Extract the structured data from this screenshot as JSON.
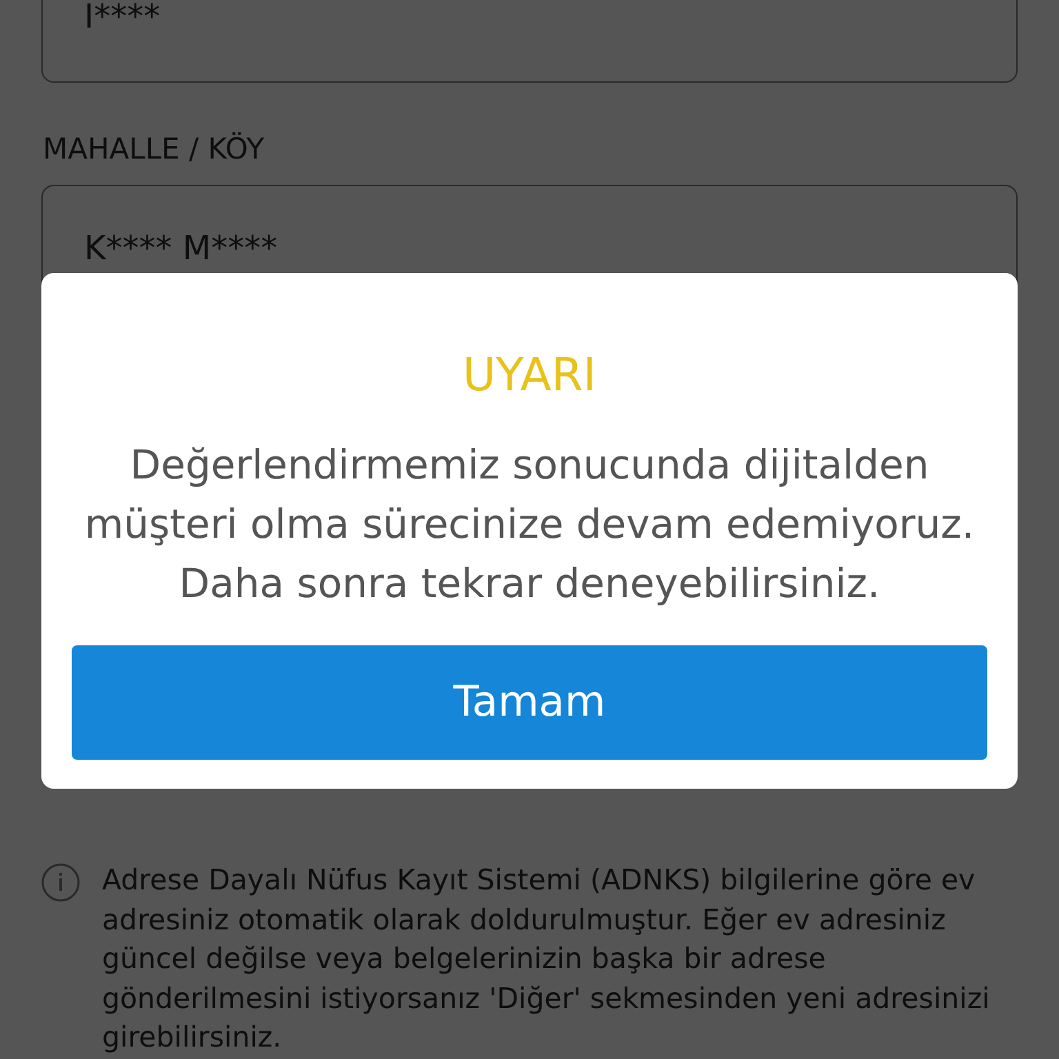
{
  "form": {
    "fields": [
      {
        "value": "I****"
      },
      {
        "label": "MAHALLE / KÖY",
        "value": "K**** M****"
      }
    ]
  },
  "dialog": {
    "title": "UYARI",
    "message": "Değerlendirmemiz sonucunda dijitalden müşteri olma sürecinize devam edemiyoruz. Daha sonra tekrar deneyebilirsiniz.",
    "button": "Tamam"
  },
  "info_note": {
    "text": "Adrese Dayalı Nüfus Kayıt Sistemi (ADNKS) bilgilerine göre ev adresiniz otomatik olarak doldurulmuştur. Eğer ev adresiniz güncel değilse veya belgelerinizin başka bir adrese gönderilmesini istiyorsanız 'Diğer' sekmesinden yeni adresinizi girebilirsiniz."
  }
}
